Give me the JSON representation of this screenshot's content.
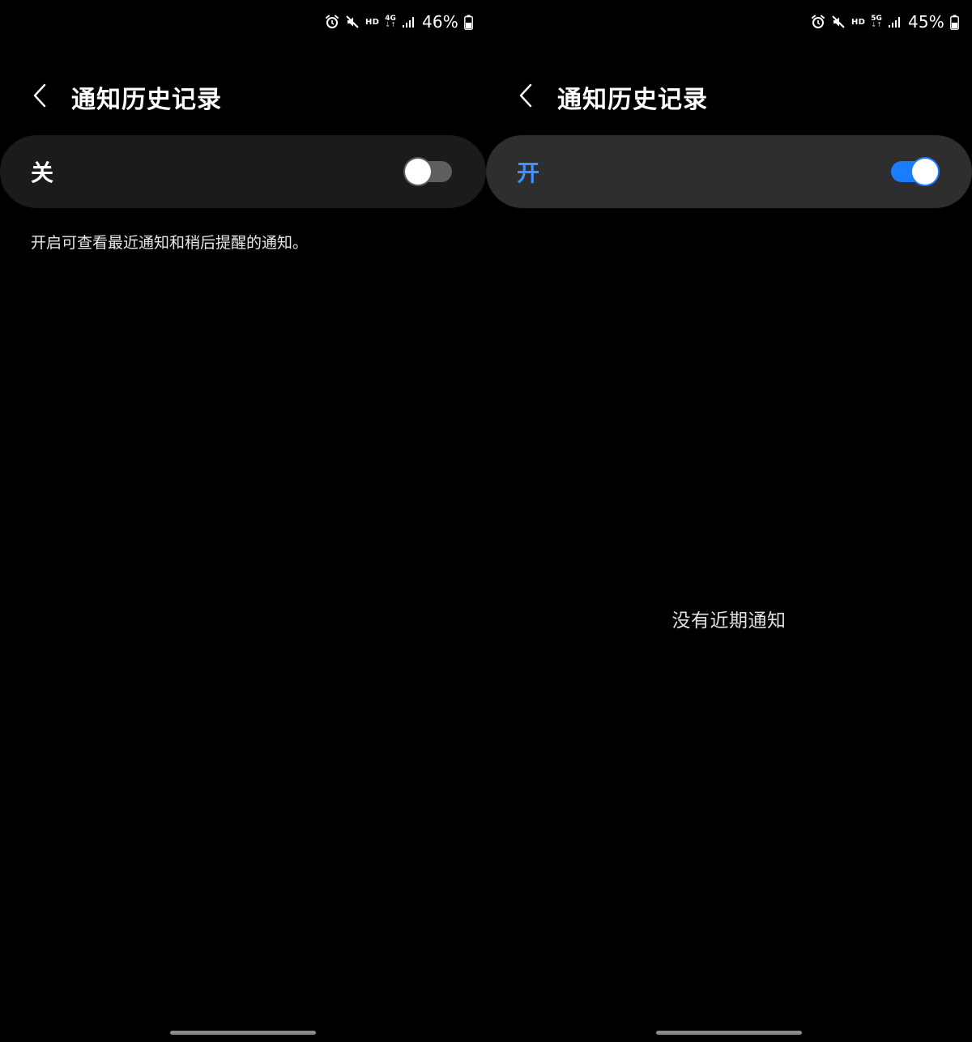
{
  "left": {
    "status": {
      "hd": "HD",
      "network": "4G",
      "battery": "46%"
    },
    "header": {
      "title": "通知历史记录"
    },
    "switch": {
      "label": "关",
      "state": "off"
    },
    "description": "开启可查看最近通知和稍后提醒的通知。"
  },
  "right": {
    "status": {
      "hd": "HD",
      "network": "5G",
      "battery": "45%"
    },
    "header": {
      "title": "通知历史记录"
    },
    "switch": {
      "label": "开",
      "state": "on"
    },
    "empty_message": "没有近期通知"
  },
  "colors": {
    "background": "#000000",
    "card_off": "#1b1b1b",
    "card_on": "#2e2e2e",
    "accent_blue": "#1a7cff",
    "label_on": "#3e91ff",
    "toggle_off_track": "#5e5e5e"
  },
  "icons": [
    "alarm-icon",
    "mute-icon",
    "signal-icon",
    "battery-icon",
    "back-chevron-icon"
  ]
}
